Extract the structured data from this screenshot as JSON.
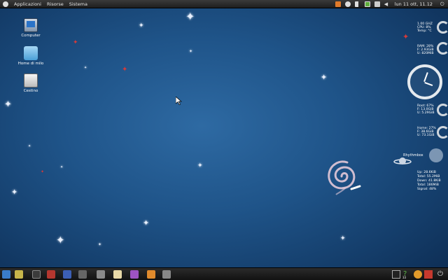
{
  "top_panel": {
    "menus": [
      "Applicazioni",
      "Risorse",
      "Sistema"
    ],
    "clock": "lun 11 ott, 11.12"
  },
  "desktop_icons": [
    {
      "label": "Computer",
      "icon": "computer-icon"
    },
    {
      "label": "Home di milo",
      "icon": "home-folder-icon"
    },
    {
      "label": "Cestino",
      "icon": "trash-icon"
    }
  ],
  "conky": {
    "cpu": [
      "1.00 GHZ",
      "CPU: 8%",
      "Temp: °C"
    ],
    "ram": [
      "RAM: 28%",
      "F: 2.93GiB",
      "U: 820MiB"
    ],
    "root": [
      "Root: 67%",
      "F: 13.0GiB",
      "U: 5.29GiB"
    ],
    "home": [
      "Home: 27%",
      "F: 38.6GiB",
      "U: 73.1GiB"
    ],
    "rhythmbox_label": "Rhythmbox",
    "net": [
      "Up: 28.6KiB",
      "Total: 55.2MiB",
      "Down: 41.8KiB",
      "Total: 186MiB",
      "Signal: 48%"
    ]
  },
  "bottom_panel": {
    "badge": "33"
  },
  "colors": {
    "wallpaper": "#1f5489",
    "panel": "#1e1e1e",
    "star_red": "#d63a3a"
  }
}
